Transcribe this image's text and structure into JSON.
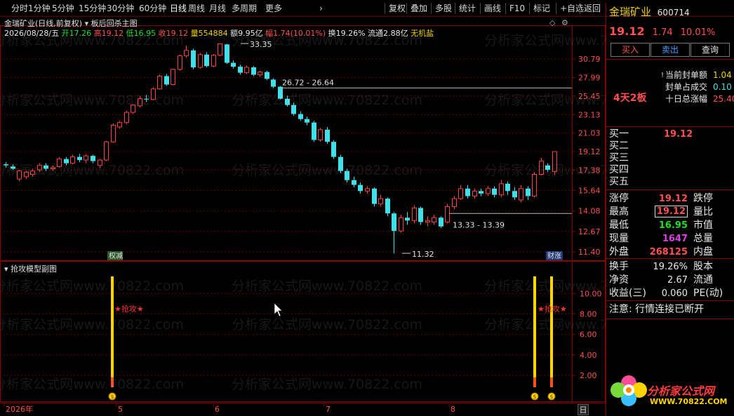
{
  "toolbar": {
    "left_items": [
      "分时",
      "1分钟",
      "5分钟",
      "15分钟",
      "30分钟",
      "60分钟",
      "日线",
      "周线",
      "月线",
      "多周期",
      "更多"
    ],
    "more_arrow": "›",
    "right_items": [
      "复权",
      "叠加",
      "多股",
      "统计",
      "画线",
      "F10",
      "标记",
      "+自选",
      "返回"
    ]
  },
  "main_chart": {
    "title": "金瑞矿业(日线,前复权)",
    "indicator_name": "板后回杀主图",
    "info": {
      "date": "2026/08/28/五",
      "open_label": "开",
      "open": "17.26",
      "high_label": "高",
      "high": "19.12",
      "low_label": "低",
      "low": "16.95",
      "close_label": "收",
      "close": "19.12",
      "volume_label": "量",
      "volume": "554884",
      "amount_label": "额",
      "amount": "9.95亿",
      "change_label": "幅",
      "change": "1.74(10.01%)",
      "turnover_label": "换",
      "turnover": "19.26%",
      "float_label": "流通",
      "float": "2.88亿",
      "org_label": "无机盐"
    },
    "annotations": {
      "high_mark": "33.35",
      "low_mark": "11.32",
      "range1": "26.72 - 26.64",
      "range2": "13.33 - 13.39"
    },
    "badges": {
      "left": "权减",
      "right": "财涨"
    }
  },
  "chart_data": {
    "type": "candlestick",
    "y_ticks": [
      "30.79",
      "27.99",
      "25.45",
      "23.13",
      "21.03",
      "19.12",
      "17.38",
      "15.64",
      "14.08",
      "12.67",
      "11.40"
    ],
    "ylim": [
      11.0,
      33.6
    ],
    "x_ticks": [
      "2026年",
      "5",
      "6",
      "7",
      "8"
    ],
    "candles": [
      {
        "o": 17.9,
        "c": 17.8,
        "h": 18.1,
        "l": 17.6
      },
      {
        "o": 17.7,
        "c": 17.5,
        "h": 17.9,
        "l": 17.4
      },
      {
        "o": 16.6,
        "c": 17.3,
        "h": 17.4,
        "l": 16.4
      },
      {
        "o": 16.8,
        "c": 17.2,
        "h": 17.3,
        "l": 16.6
      },
      {
        "o": 17.0,
        "c": 17.3,
        "h": 17.5,
        "l": 16.8
      },
      {
        "o": 17.4,
        "c": 17.8,
        "h": 18.0,
        "l": 17.2
      },
      {
        "o": 17.8,
        "c": 17.5,
        "h": 18.0,
        "l": 17.3
      },
      {
        "o": 17.5,
        "c": 17.6,
        "h": 17.8,
        "l": 17.3
      },
      {
        "o": 17.7,
        "c": 18.4,
        "h": 18.6,
        "l": 17.6
      },
      {
        "o": 18.4,
        "c": 18.0,
        "h": 18.6,
        "l": 17.8
      },
      {
        "o": 18.0,
        "c": 18.6,
        "h": 18.8,
        "l": 17.9
      },
      {
        "o": 18.6,
        "c": 18.3,
        "h": 18.9,
        "l": 18.1
      },
      {
        "o": 18.3,
        "c": 18.7,
        "h": 18.9,
        "l": 18.0
      },
      {
        "o": 18.7,
        "c": 18.2,
        "h": 18.8,
        "l": 18.0
      },
      {
        "o": 17.8,
        "c": 18.3,
        "h": 18.4,
        "l": 17.6
      },
      {
        "o": 18.3,
        "c": 20.1,
        "h": 20.2,
        "l": 18.2
      },
      {
        "o": 20.1,
        "c": 21.9,
        "h": 22.1,
        "l": 20.0
      },
      {
        "o": 21.7,
        "c": 22.2,
        "h": 22.4,
        "l": 21.5
      },
      {
        "o": 22.2,
        "c": 23.4,
        "h": 23.6,
        "l": 22.0
      },
      {
        "o": 23.4,
        "c": 24.3,
        "h": 24.4,
        "l": 23.2
      },
      {
        "o": 24.2,
        "c": 25.1,
        "h": 25.4,
        "l": 24.0
      },
      {
        "o": 25.1,
        "c": 25.0,
        "h": 25.6,
        "l": 24.7
      },
      {
        "o": 25.0,
        "c": 26.4,
        "h": 26.6,
        "l": 24.9
      },
      {
        "o": 26.4,
        "c": 28.2,
        "h": 28.4,
        "l": 26.3
      },
      {
        "o": 28.2,
        "c": 27.0,
        "h": 28.5,
        "l": 26.8
      },
      {
        "o": 27.0,
        "c": 29.2,
        "h": 29.3,
        "l": 26.9
      },
      {
        "o": 29.2,
        "c": 31.3,
        "h": 31.5,
        "l": 29.0
      },
      {
        "o": 31.3,
        "c": 32.2,
        "h": 33.0,
        "l": 31.0
      },
      {
        "o": 32.2,
        "c": 29.5,
        "h": 32.5,
        "l": 29.2
      },
      {
        "o": 29.5,
        "c": 31.5,
        "h": 31.8,
        "l": 29.3
      },
      {
        "o": 31.5,
        "c": 29.7,
        "h": 31.9,
        "l": 29.5
      },
      {
        "o": 29.7,
        "c": 31.4,
        "h": 31.6,
        "l": 29.5
      },
      {
        "o": 31.4,
        "c": 33.3,
        "h": 33.35,
        "l": 31.2
      },
      {
        "o": 33.2,
        "c": 30.2,
        "h": 33.3,
        "l": 30.0
      },
      {
        "o": 30.2,
        "c": 29.6,
        "h": 30.6,
        "l": 29.3
      },
      {
        "o": 29.6,
        "c": 28.7,
        "h": 29.9,
        "l": 28.4
      },
      {
        "o": 28.7,
        "c": 29.5,
        "h": 29.8,
        "l": 28.5
      },
      {
        "o": 29.5,
        "c": 28.4,
        "h": 29.7,
        "l": 28.2
      },
      {
        "o": 28.4,
        "c": 28.8,
        "h": 29.0,
        "l": 28.1
      },
      {
        "o": 28.8,
        "c": 27.8,
        "h": 29.0,
        "l": 27.6
      },
      {
        "o": 27.7,
        "c": 26.7,
        "h": 27.9,
        "l": 26.5
      },
      {
        "o": 26.7,
        "c": 25.1,
        "h": 26.8,
        "l": 25.0
      },
      {
        "o": 25.1,
        "c": 24.3,
        "h": 25.5,
        "l": 24.1
      },
      {
        "o": 24.3,
        "c": 23.2,
        "h": 24.6,
        "l": 23.0
      },
      {
        "o": 23.2,
        "c": 22.6,
        "h": 23.5,
        "l": 22.4
      },
      {
        "o": 22.6,
        "c": 22.2,
        "h": 22.9,
        "l": 21.9
      },
      {
        "o": 22.2,
        "c": 20.3,
        "h": 22.4,
        "l": 20.1
      },
      {
        "o": 20.3,
        "c": 21.4,
        "h": 21.6,
        "l": 20.1
      },
      {
        "o": 21.4,
        "c": 20.1,
        "h": 21.7,
        "l": 19.9
      },
      {
        "o": 20.1,
        "c": 18.6,
        "h": 20.3,
        "l": 18.4
      },
      {
        "o": 18.6,
        "c": 17.3,
        "h": 18.8,
        "l": 17.1
      },
      {
        "o": 17.3,
        "c": 16.5,
        "h": 17.5,
        "l": 16.3
      },
      {
        "o": 16.5,
        "c": 16.1,
        "h": 16.8,
        "l": 15.9
      },
      {
        "o": 16.1,
        "c": 15.6,
        "h": 16.3,
        "l": 15.4
      },
      {
        "o": 15.6,
        "c": 15.8,
        "h": 16.0,
        "l": 15.4
      },
      {
        "o": 15.8,
        "c": 14.6,
        "h": 15.9,
        "l": 14.4
      },
      {
        "o": 14.6,
        "c": 15.0,
        "h": 15.3,
        "l": 14.4
      },
      {
        "o": 15.0,
        "c": 13.9,
        "h": 15.1,
        "l": 13.7
      },
      {
        "o": 13.9,
        "c": 12.7,
        "h": 14.0,
        "l": 11.32
      },
      {
        "o": 12.7,
        "c": 13.6,
        "h": 13.8,
        "l": 12.6
      },
      {
        "o": 13.6,
        "c": 13.4,
        "h": 14.0,
        "l": 13.1
      },
      {
        "o": 13.4,
        "c": 14.3,
        "h": 14.5,
        "l": 13.2
      },
      {
        "o": 14.3,
        "c": 13.3,
        "h": 14.4,
        "l": 13.1
      },
      {
        "o": 13.3,
        "c": 13.4,
        "h": 13.7,
        "l": 13.0
      },
      {
        "o": 13.3,
        "c": 13.6,
        "h": 13.8,
        "l": 13.1
      },
      {
        "o": 13.6,
        "c": 13.0,
        "h": 13.7,
        "l": 12.9
      },
      {
        "o": 13.3,
        "c": 14.4,
        "h": 14.6,
        "l": 13.2
      },
      {
        "o": 14.4,
        "c": 15.0,
        "h": 15.2,
        "l": 14.2
      },
      {
        "o": 15.0,
        "c": 15.8,
        "h": 16.1,
        "l": 14.9
      },
      {
        "o": 15.8,
        "c": 15.2,
        "h": 16.1,
        "l": 15.0
      },
      {
        "o": 15.2,
        "c": 15.6,
        "h": 15.8,
        "l": 15.0
      },
      {
        "o": 15.6,
        "c": 15.4,
        "h": 15.8,
        "l": 15.2
      },
      {
        "o": 15.4,
        "c": 15.8,
        "h": 16.0,
        "l": 15.2
      },
      {
        "o": 15.8,
        "c": 15.3,
        "h": 16.0,
        "l": 15.1
      },
      {
        "o": 15.3,
        "c": 16.2,
        "h": 16.5,
        "l": 15.1
      },
      {
        "o": 16.2,
        "c": 15.6,
        "h": 16.4,
        "l": 15.3
      },
      {
        "o": 15.6,
        "c": 15.1,
        "h": 15.9,
        "l": 14.9
      },
      {
        "o": 14.9,
        "c": 15.8,
        "h": 16.1,
        "l": 14.7
      },
      {
        "o": 15.8,
        "c": 15.2,
        "h": 16.0,
        "l": 14.9
      },
      {
        "o": 15.2,
        "c": 17.0,
        "h": 17.2,
        "l": 15.1
      },
      {
        "o": 17.0,
        "c": 18.2,
        "h": 18.5,
        "l": 16.9
      },
      {
        "o": 17.8,
        "c": 17.4,
        "h": 18.0,
        "l": 17.2
      },
      {
        "o": 17.26,
        "c": 19.12,
        "h": 19.12,
        "l": 16.95
      }
    ]
  },
  "sub_chart": {
    "title": "抢攻模型副图",
    "y_ticks": [
      "10.00",
      "8.00",
      "6.00",
      "4.00",
      "2.00"
    ],
    "signal_label": "★抢攻★",
    "coin_symbol": "$"
  },
  "right_panel": {
    "stock_name": "金瑞矿业",
    "code": "600714",
    "price": "19.12",
    "change": "1.74",
    "change_pct": "10.01%",
    "buttons": [
      "买入",
      "卖出",
      "查询"
    ],
    "seal_rows": [
      {
        "label": "当前封单额",
        "value": "1.04"
      },
      {
        "label": "封单占成交",
        "value": "0.10"
      },
      {
        "label": "十日总涨幅",
        "value": "25.40"
      }
    ],
    "board_tag": "4天2板",
    "bid_rows": [
      {
        "label": "买一",
        "value": "19.12"
      },
      {
        "label": "买二",
        "value": ""
      },
      {
        "label": "买三",
        "value": ""
      },
      {
        "label": "买四",
        "value": ""
      },
      {
        "label": "买五",
        "value": ""
      }
    ],
    "stats": [
      {
        "l1": "涨停",
        "v1": "19.12",
        "l2": "跌停",
        "c": "red"
      },
      {
        "l1": "最高",
        "v1": "19.12",
        "l2": "量比",
        "c": "red"
      },
      {
        "l1": "最低",
        "v1": "16.95",
        "l2": "市值",
        "c": "green"
      },
      {
        "l1": "现量",
        "v1": "1647",
        "l2": "总量",
        "c": "magenta"
      },
      {
        "l1": "外盘",
        "v1": "268125",
        "l2": "内盘",
        "c": "red"
      }
    ],
    "stats2": [
      {
        "l1": "换手",
        "v1": "19.26%",
        "l2": "股本"
      },
      {
        "l1": "净资",
        "v1": "2.67",
        "l2": "流通"
      },
      {
        "l1": "收益(三)",
        "v1": "0.060",
        "l2": "PE(动)"
      }
    ],
    "notice": "注意: 行情连接已断开"
  },
  "watermark": "分析家公式网www.70822.com",
  "logo": {
    "title": "分析家公式网",
    "url": "WWW.70822.COM"
  },
  "day_tab": "日"
}
